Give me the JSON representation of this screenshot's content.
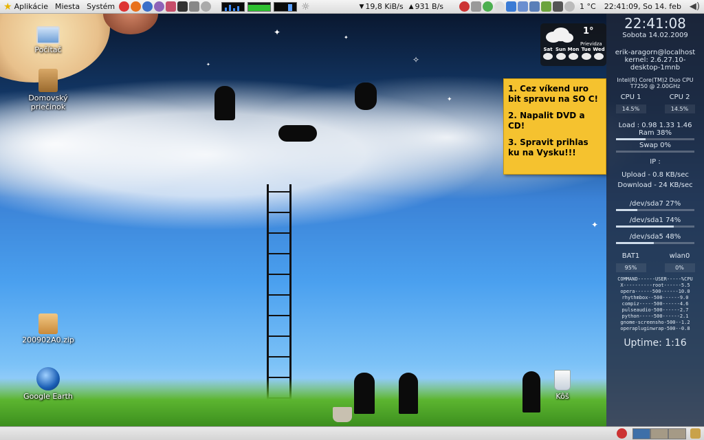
{
  "top_panel": {
    "menus": [
      "Aplikácie",
      "Miesta",
      "Systém"
    ],
    "net_down": "19,8 KiB/s",
    "net_up": "931 B/s",
    "temperature": "1 °C",
    "clock": "22:41:09, So 14. feb"
  },
  "desktop_icons": [
    {
      "label": "Počítač"
    },
    {
      "label": "Domovský priečinok"
    },
    {
      "label": "200902A0.zip"
    },
    {
      "label": "Google Earth"
    },
    {
      "label": "Kôš"
    }
  ],
  "note": {
    "items": [
      "1. Cez víkend uro bit spravu na SO C!",
      "2. Napalit DVD a CD!",
      "3. Spravit prihlas ku na Vysku!!!"
    ]
  },
  "weather": {
    "temp": "1°",
    "city": "Prievidza",
    "days": [
      "Sat",
      "Sun",
      "Mon",
      "Tue",
      "Wed"
    ]
  },
  "conky": {
    "time": "22:41:08",
    "date": "Sobota 14.02.2009",
    "user_host": "erik-aragorn@localhost",
    "kernel": "kernel: 2.6.27.10-desktop-1mnb",
    "cpu_model": "Intel(R) Core(TM)2 Duo CPU T7250 @ 2.00GHz",
    "cpu1_label": "CPU 1",
    "cpu1_value": "14.5%",
    "cpu2_label": "CPU 2",
    "cpu2_value": "14.5%",
    "load": "Load : 0.98 1.33 1.46",
    "ram": "Ram 38%",
    "ram_fraction": 0.38,
    "swap": "Swap 0%",
    "swap_fraction": 0,
    "ip": "IP :",
    "upload": "Upload - 0.8 KB/sec",
    "download": "Download - 24  KB/sec",
    "disks": [
      {
        "label": "/dev/sda7 27%",
        "fraction": 0.27
      },
      {
        "label": "/dev/sda1 74%",
        "fraction": 0.74
      },
      {
        "label": "/dev/sda5 48%",
        "fraction": 0.48
      }
    ],
    "bat_label": "BAT1",
    "bat_value": "95%",
    "wlan_label": "wlan0",
    "wlan_value": "0%",
    "processes": [
      "COMMAND------USER-----%CPU",
      "X----------root------5.5",
      "opera------500------10.0",
      "rhythmbox--500------9.0",
      "compiz-----500------4.6",
      "pulseaudio-500------2.7",
      "python-----500------2.1",
      "gnome-screensho-500--1.2",
      "operapluginwrap-500--0.8"
    ],
    "uptime": "Uptime: 1:16"
  },
  "colors": {
    "note_bg": "#f5c22f",
    "panel_bg": "#dcdcdc",
    "conky_bg": "#1e283c"
  }
}
